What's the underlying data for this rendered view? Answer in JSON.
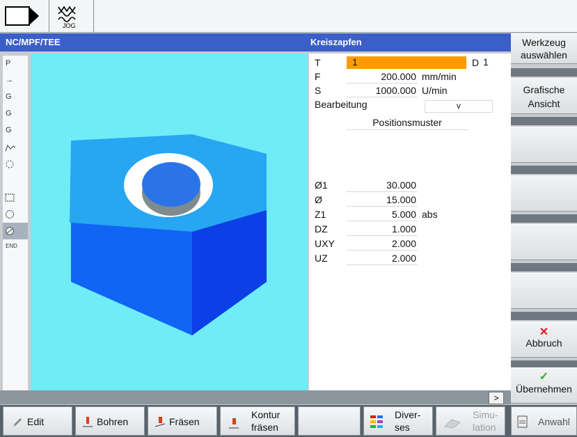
{
  "top": {
    "mode_label": "JOG"
  },
  "title": {
    "program": "NC/MPF/TEE",
    "cycle": "Kreiszapfen"
  },
  "left_icons": [
    {
      "label": "P",
      "icon": "program-icon"
    },
    {
      "label": "→",
      "icon": "arrow-right-icon"
    },
    {
      "label": "G",
      "icon": "g-code-icon"
    },
    {
      "label": "G",
      "icon": "g-code-icon"
    },
    {
      "label": "G",
      "icon": "g-code-icon"
    },
    {
      "label": "",
      "icon": "path-icon"
    },
    {
      "label": "",
      "icon": "circle-dashed-icon"
    },
    {
      "label": "",
      "icon": "pocket-icon"
    },
    {
      "label": "",
      "icon": "spigot-icon"
    },
    {
      "label": "",
      "icon": "selected-cycle-icon"
    },
    {
      "label": "END",
      "icon": "end-icon"
    }
  ],
  "params": {
    "T": {
      "label": "T",
      "value": "1",
      "d_label": "D",
      "d_value": "1"
    },
    "F": {
      "label": "F",
      "value": "200.000",
      "unit": "mm/min"
    },
    "S": {
      "label": "S",
      "value": "1000.000",
      "unit": "U/min"
    },
    "bearbeitung": {
      "label": "Bearbeitung",
      "value": "v"
    },
    "positionsmuster": {
      "label": "Positionsmuster"
    },
    "d1": {
      "label": "Ø1",
      "value": "30.000"
    },
    "d": {
      "label": "Ø",
      "value": "15.000"
    },
    "z1": {
      "label": "Z1",
      "value": "5.000",
      "unit": "abs"
    },
    "dz": {
      "label": "DZ",
      "value": "1.000"
    },
    "uxy": {
      "label": "UXY",
      "value": "2.000"
    },
    "uz": {
      "label": "UZ",
      "value": "2.000"
    }
  },
  "status": {
    "next_label": ">"
  },
  "vertical_softkeys": {
    "werkzeug_line1": "Werkzeug",
    "werkzeug_line2": "auswählen",
    "grafische_line1": "Grafische",
    "grafische_line2": "Ansicht",
    "abbruch": "Abbruch",
    "uebernehmen": "Übernehmen"
  },
  "horizontal_softkeys": {
    "edit": "Edit",
    "bohren": "Bohren",
    "fraesen": "Fräsen",
    "kontur_line1": "Kontur",
    "kontur_line2": "fräsen",
    "diverses_line1": "Diver-",
    "diverses_line2": "ses",
    "simulation_line1": "Simu-",
    "simulation_line2": "lation",
    "anwahl": "Anwahl"
  },
  "colors": {
    "title_bar": "#3a5fc8",
    "graphic_bg": "#6fecf6",
    "block_top": "#27a6f2",
    "block_front": "#1165f4",
    "block_side": "#0c3fe6",
    "highlight_field": "#ff9b00",
    "cancel_red": "#e01a1a",
    "accept_green": "#27b527"
  }
}
